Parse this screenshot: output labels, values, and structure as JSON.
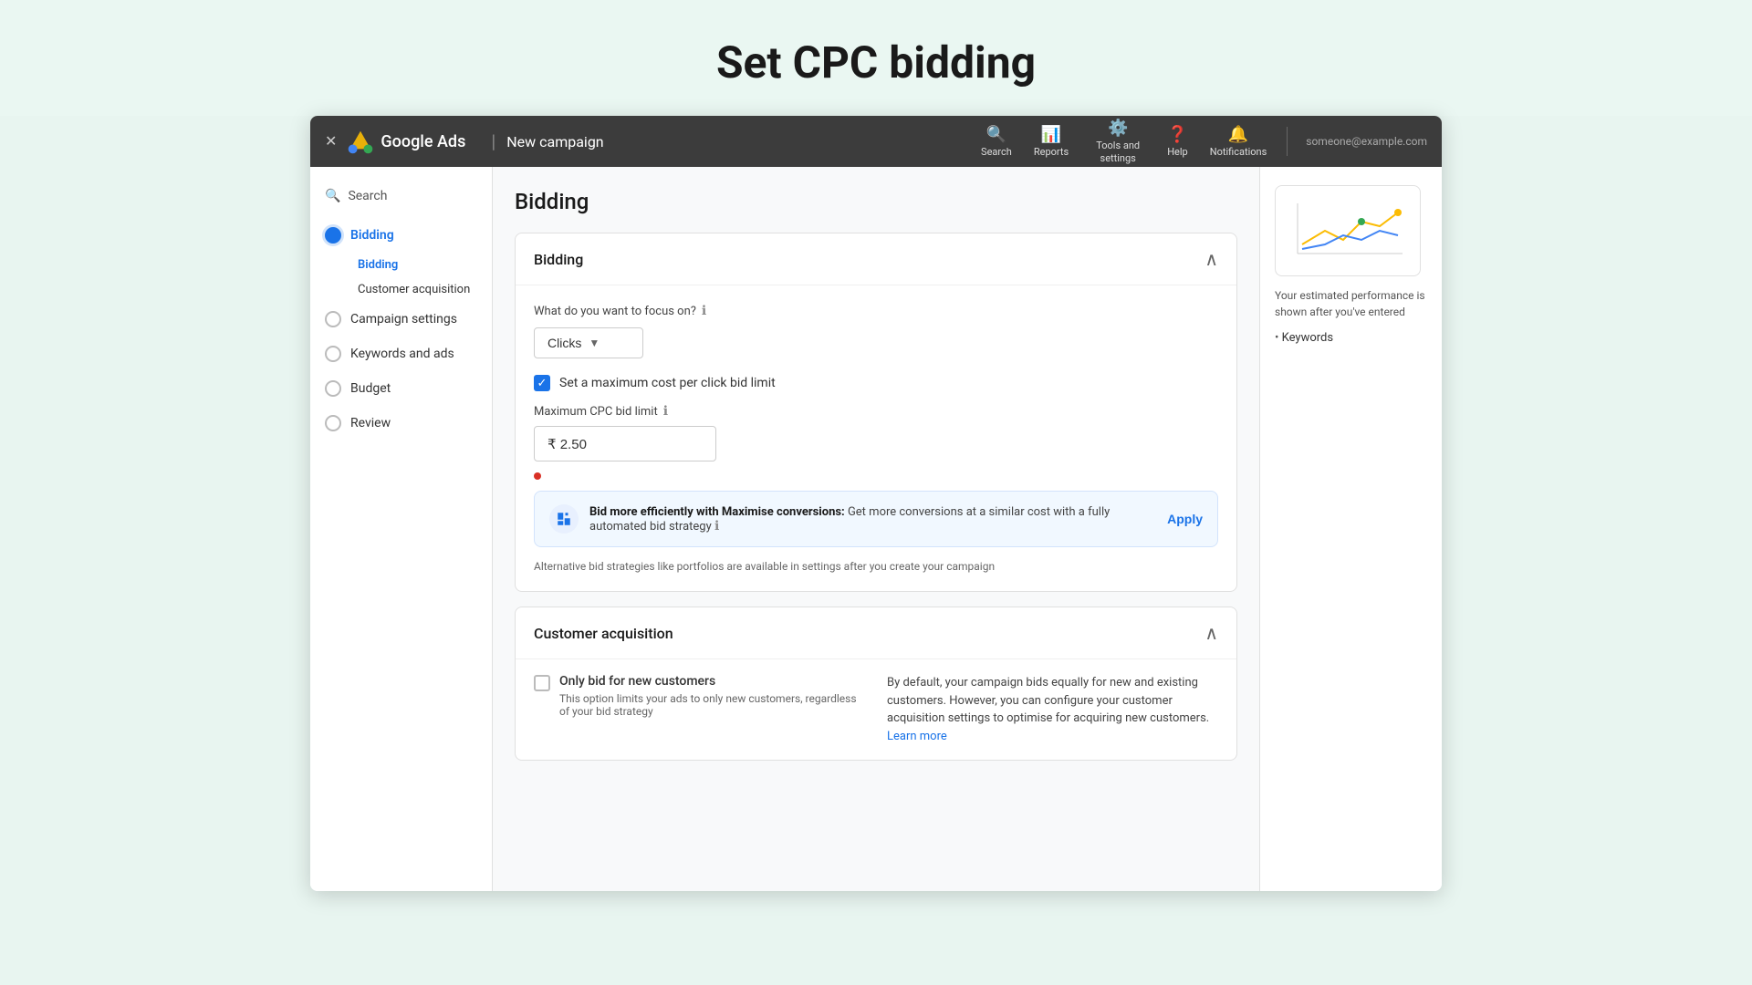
{
  "page": {
    "title": "Set CPC bidding"
  },
  "topnav": {
    "app_name": "Google Ads",
    "campaign": "New campaign",
    "search_label": "Search",
    "reports_label": "Reports",
    "tools_label": "Tools and settings",
    "help_label": "Help",
    "notifications_label": "Notifications",
    "profile_text": "someone@example.com"
  },
  "sidebar": {
    "search_label": "Search",
    "items": [
      {
        "id": "bidding",
        "label": "Bidding",
        "active": true
      },
      {
        "id": "campaign-settings",
        "label": "Campaign settings",
        "active": false
      },
      {
        "id": "keywords-and-ads",
        "label": "Keywords and ads",
        "active": false
      },
      {
        "id": "budget",
        "label": "Budget",
        "active": false
      },
      {
        "id": "review",
        "label": "Review",
        "active": false
      }
    ],
    "sub_items": [
      {
        "id": "bidding-sub",
        "label": "Bidding",
        "active": true
      },
      {
        "id": "customer-acquisition-sub",
        "label": "Customer acquisition",
        "active": false
      }
    ]
  },
  "content": {
    "title": "Bidding",
    "bidding_card": {
      "header": "Bidding",
      "focus_label": "What do you want to focus on?",
      "focus_value": "Clicks",
      "checkbox_label": "Set a maximum cost per click bid limit",
      "max_cpc_label": "Maximum CPC bid limit",
      "max_cpc_value": "₹ 2.50",
      "bid_banner": {
        "text_bold": "Bid more efficiently with Maximise conversions:",
        "text_rest": " Get more conversions at a similar cost with a fully automated bid strategy",
        "apply_label": "Apply"
      },
      "alt_bid_note": "Alternative bid strategies like portfolios are available in settings after you create your campaign"
    },
    "customer_acquisition_card": {
      "header": "Customer acquisition",
      "checkbox_label": "Only bid for new customers",
      "checkbox_sublabel": "This option limits your ads to only new customers, regardless of your bid strategy",
      "right_text": "By default, your campaign bids equally for new and existing customers. However, you can configure your customer acquisition settings to optimise for acquiring new customers.",
      "learn_more": "Learn more"
    }
  },
  "right_panel": {
    "perf_note": "Your estimated performance is shown after you've entered",
    "keywords_label": "Keywords"
  }
}
